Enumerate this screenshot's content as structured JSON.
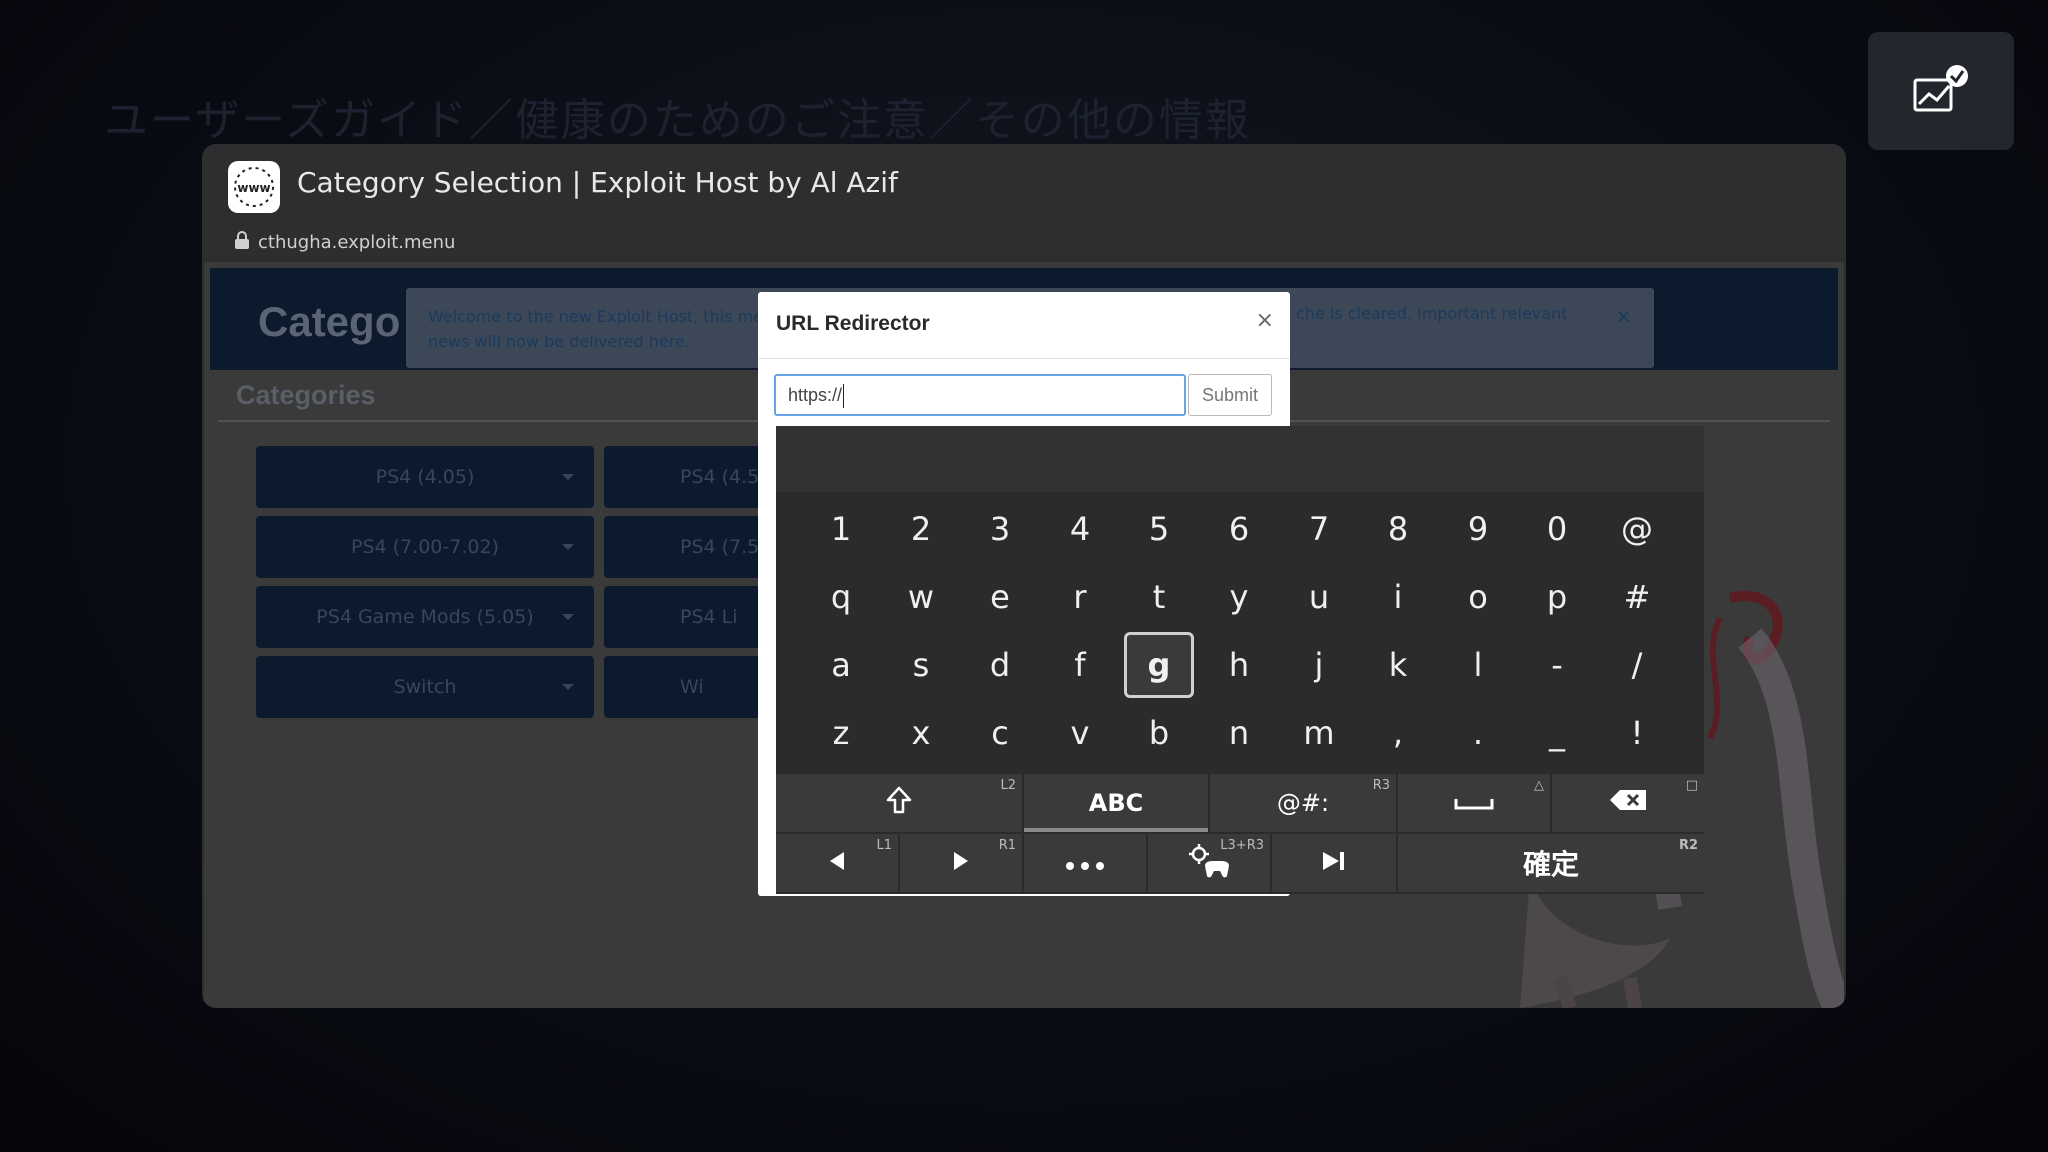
{
  "background_title": "ユーザーズガイド／健康のためのご注意／その他の情報",
  "browser": {
    "page_title": "Category Selection | Exploit Host by Al Azif",
    "url": "cthugha.exploit.menu",
    "site_icon_text": "www"
  },
  "webpage": {
    "header_title": "Catego",
    "alert_left": "Welcome to the new Exploit Host, this me news will now be delivered here.",
    "alert_right": "che is cleared. Important relevant",
    "alert_close": "×",
    "categories_heading": "Categories",
    "categories": [
      {
        "label": "PS4 (4.05)"
      },
      {
        "label": "PS4 (7.00-7.02)"
      },
      {
        "label": "PS4 Game Mods (5.05)"
      },
      {
        "label": "Switch"
      }
    ],
    "categories_col2": [
      {
        "label": "PS4 (4.5"
      },
      {
        "label": "PS4 (7.5"
      },
      {
        "label": "PS4 Li"
      },
      {
        "label": "Wi"
      }
    ]
  },
  "modal": {
    "title": "URL Redirector",
    "close": "×",
    "input_value": "https://",
    "submit_label": "Submit"
  },
  "keyboard": {
    "rows": [
      [
        "1",
        "2",
        "3",
        "4",
        "5",
        "6",
        "7",
        "8",
        "9",
        "0",
        "@"
      ],
      [
        "q",
        "w",
        "e",
        "r",
        "t",
        "y",
        "u",
        "i",
        "o",
        "p",
        "#"
      ],
      [
        "a",
        "s",
        "d",
        "f",
        "g",
        "h",
        "j",
        "k",
        "l",
        "-",
        "/"
      ],
      [
        "z",
        "x",
        "c",
        "v",
        "b",
        "n",
        "m",
        ",",
        ".",
        "_",
        "!"
      ]
    ],
    "focused_key": "g",
    "mode_abc": "ABC",
    "mode_symbols": "@#:",
    "confirm_label": "確定",
    "tags": {
      "shift": "L2",
      "symbols": "R3",
      "space": "△",
      "backspace": "□",
      "left": "L1",
      "right": "R1",
      "pointer": "L3+R3",
      "confirm": "R2"
    }
  }
}
